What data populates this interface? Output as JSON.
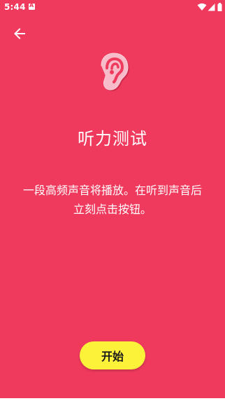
{
  "status_bar": {
    "time": "5:44"
  },
  "header": {
    "back_icon": "arrow-back-icon"
  },
  "main": {
    "hero_icon": "ear-icon",
    "title": "听力测试",
    "description": "一段高频声音将播放。在听到声音后立刻点击按钮。",
    "start_label": "开始"
  },
  "colors": {
    "background": "#EF3A5D",
    "button": "#FDF23A",
    "text": "#FFFFFF"
  }
}
